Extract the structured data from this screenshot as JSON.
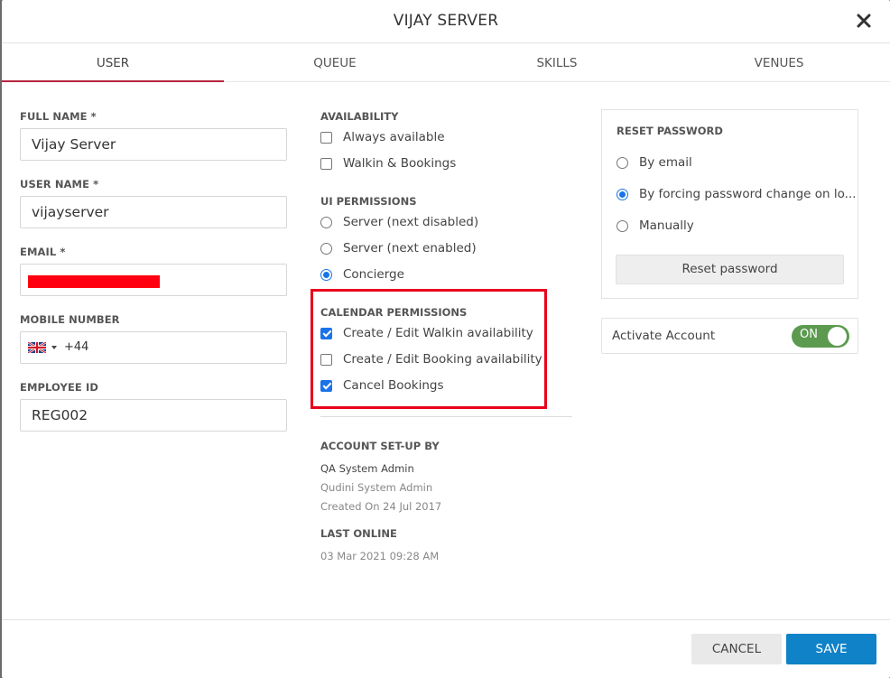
{
  "modal": {
    "title": "VIJAY SERVER"
  },
  "tabs": [
    {
      "label": "USER"
    },
    {
      "label": "QUEUE"
    },
    {
      "label": "SKILLS"
    },
    {
      "label": "VENUES"
    }
  ],
  "form": {
    "full_name": {
      "label": "FULL NAME *",
      "value": "Vijay Server"
    },
    "user_name": {
      "label": "USER NAME *",
      "value": "vijayserver"
    },
    "email": {
      "label": "EMAIL *",
      "value": ""
    },
    "mobile": {
      "label": "MOBILE NUMBER",
      "country": "GB",
      "value": "+44"
    },
    "employee_id": {
      "label": "EMPLOYEE ID",
      "value": "REG002"
    }
  },
  "availability": {
    "label": "AVAILABILITY",
    "options": [
      {
        "label": "Always available",
        "checked": false
      },
      {
        "label": "Walkin & Bookings",
        "checked": false
      }
    ]
  },
  "ui_permissions": {
    "label": "UI PERMISSIONS",
    "options": [
      {
        "label": "Server (next disabled)",
        "selected": false
      },
      {
        "label": "Server (next enabled)",
        "selected": false
      },
      {
        "label": "Concierge",
        "selected": true
      }
    ]
  },
  "calendar_permissions": {
    "label": "CALENDAR PERMISSIONS",
    "options": [
      {
        "label": "Create / Edit Walkin availability",
        "checked": true
      },
      {
        "label": "Create / Edit Booking availability",
        "checked": false
      },
      {
        "label": "Cancel Bookings",
        "checked": true
      }
    ],
    "highlight_color": "#e8001c"
  },
  "account_setup": {
    "label": "ACCOUNT SET-UP BY",
    "name": "QA System Admin",
    "role": "Qudini System Admin",
    "created": "Created On 24 Jul 2017"
  },
  "last_online": {
    "label": "LAST ONLINE",
    "value": "03 Mar 2021 09:28 AM"
  },
  "reset_password": {
    "title": "RESET PASSWORD",
    "options": [
      {
        "label": "By email",
        "selected": false
      },
      {
        "label": "By forcing password change on lo...",
        "selected": true
      },
      {
        "label": "Manually",
        "selected": false
      }
    ],
    "button": "Reset password"
  },
  "activate": {
    "label": "Activate Account",
    "toggle": "ON",
    "color": "#5b9a4f"
  },
  "footer": {
    "cancel": "CANCEL",
    "save": "SAVE",
    "save_color": "#0f82c8"
  }
}
